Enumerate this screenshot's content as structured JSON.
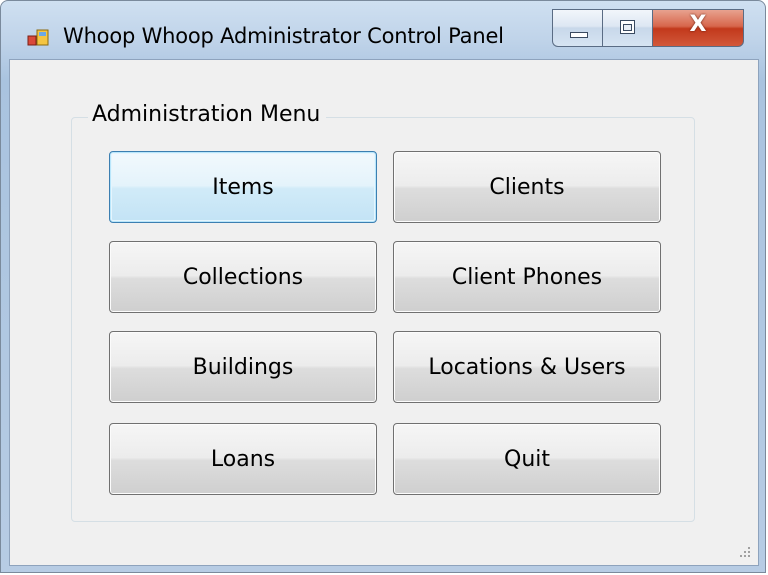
{
  "window": {
    "title": "Whoop Whoop Administrator Control Panel",
    "caption_buttons": {
      "minimize_icon": "minimize-icon",
      "maximize_icon": "maximize-icon",
      "close_label": "X"
    }
  },
  "group": {
    "label": "Administration Menu"
  },
  "buttons": {
    "items": "Items",
    "clients": "Clients",
    "collections": "Collections",
    "client_phones": "Client Phones",
    "buildings": "Buildings",
    "locations_users": "Locations & Users",
    "loans": "Loans",
    "quit": "Quit"
  },
  "colors": {
    "focus_border": "#3c7fb1",
    "close_button": "#c2391c",
    "client_background": "#f0f0f0"
  }
}
